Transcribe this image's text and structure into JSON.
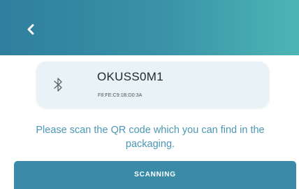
{
  "header": {
    "back_icon": "chevron-left-icon",
    "background_gradient": [
      "#2f7e9d",
      "#4db5b5"
    ]
  },
  "device": {
    "icon": "bluetooth-icon",
    "name": "OKUSS0M1",
    "mac": "F8:FE:C9:1B:D0:3A"
  },
  "instruction": "Please scan the QR code which you can find in the packaging.",
  "scan_button": {
    "label": "SCANNING",
    "color": "#3a8aa8"
  }
}
